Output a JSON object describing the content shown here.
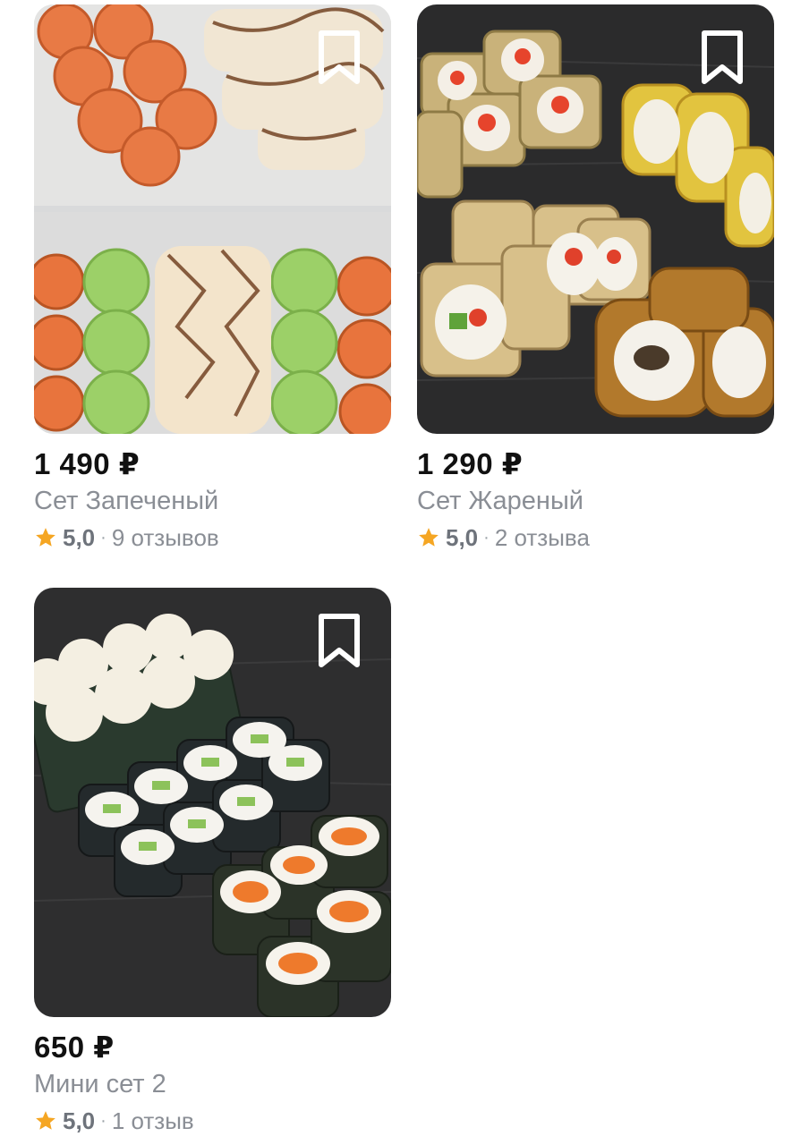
{
  "products": [
    {
      "price": "1 490 ₽",
      "title": "Сет Запеченый",
      "rating": "5,0",
      "separator": "·",
      "reviews": "9 отзывов",
      "icons": {
        "bookmark": "bookmark-icon",
        "star": "star-icon"
      }
    },
    {
      "price": "1 290 ₽",
      "title": "Сет Жареный",
      "rating": "5,0",
      "separator": "·",
      "reviews": "2 отзыва",
      "icons": {
        "bookmark": "bookmark-icon",
        "star": "star-icon"
      }
    },
    {
      "price": "650 ₽",
      "title": "Мини сет 2",
      "rating": "5,0",
      "separator": "·",
      "reviews": "1 отзыв",
      "icons": {
        "bookmark": "bookmark-icon",
        "star": "star-icon"
      }
    }
  ],
  "colors": {
    "price": "#111111",
    "title": "#8a8e95",
    "star": "#f5a623"
  }
}
